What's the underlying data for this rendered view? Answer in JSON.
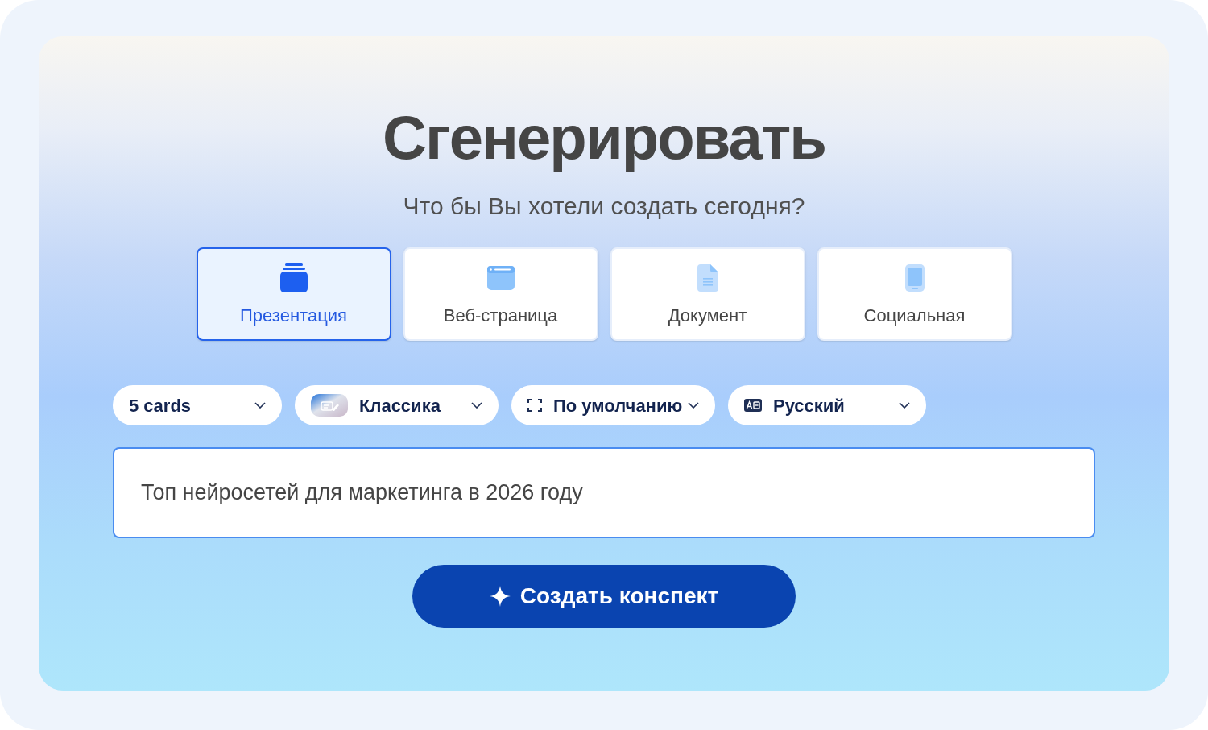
{
  "title": "Сгенерировать",
  "subtitle": "Что бы Вы хотели создать сегодня?",
  "types": [
    {
      "kind": "presentation",
      "label": "Презентация",
      "selected": true
    },
    {
      "kind": "webpage",
      "label": "Веб-страница",
      "selected": false
    },
    {
      "kind": "document",
      "label": "Документ",
      "selected": false
    },
    {
      "kind": "social",
      "label": "Социальная",
      "selected": false
    }
  ],
  "options": [
    {
      "kind": "cards",
      "value": "5 cards"
    },
    {
      "kind": "theme",
      "value": "Классика"
    },
    {
      "kind": "format",
      "value": "По умолчанию"
    },
    {
      "kind": "language",
      "value": "Русский"
    }
  ],
  "prompt": {
    "value": "Топ нейросетей для маркетинга в 2026 году"
  },
  "submit": {
    "label": "Создать конспект"
  }
}
